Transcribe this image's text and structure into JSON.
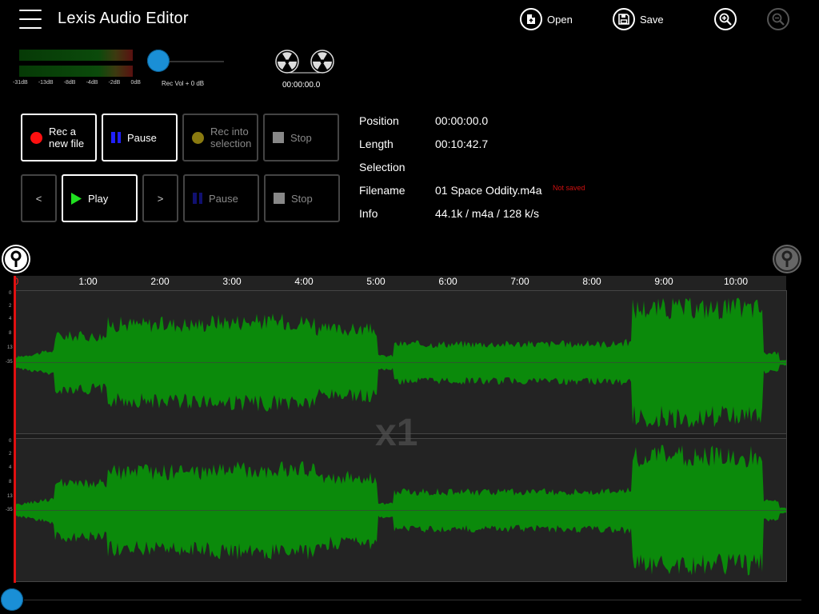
{
  "header": {
    "title": "Lexis Audio Editor",
    "open_label": "Open",
    "save_label": "Save"
  },
  "meter": {
    "scale": [
      "-31dB",
      "-13dB",
      "-8dB",
      "-4dB",
      "-2dB",
      "0dB"
    ],
    "rec_vol_label": "Rec Vol + 0 dB",
    "time_readout": "00:00:00.0"
  },
  "record_buttons": {
    "rec_new_line1": "Rec a",
    "rec_new_line2": "new file",
    "pause": "Pause",
    "rec_sel_line1": "Rec into",
    "rec_sel_line2": "selection",
    "stop": "Stop"
  },
  "play_buttons": {
    "prev": "<",
    "play": "Play",
    "next": ">",
    "pause": "Pause",
    "stop": "Stop"
  },
  "info": {
    "position_label": "Position",
    "position_value": "00:00:00.0",
    "length_label": "Length",
    "length_value": "00:10:42.7",
    "selection_label": "Selection",
    "selection_value": "",
    "filename_label": "Filename",
    "filename_value": "01 Space Oddity.m4a",
    "not_saved": "Not saved",
    "info_label": "Info",
    "info_value": "44.1k / m4a / 128 k/s"
  },
  "timeline": {
    "labels": [
      "0",
      "1:00",
      "2:00",
      "3:00",
      "4:00",
      "5:00",
      "6:00",
      "7:00",
      "8:00",
      "9:00",
      "10:00"
    ],
    "db_scale": [
      "0",
      "2",
      "4",
      "8",
      "13",
      "-35"
    ],
    "zoom_label": "x1"
  },
  "colors": {
    "waveform": "#0b8a0b",
    "playhead": "#e01010",
    "accent": "#1a8fd6",
    "not_saved": "#d01010"
  }
}
